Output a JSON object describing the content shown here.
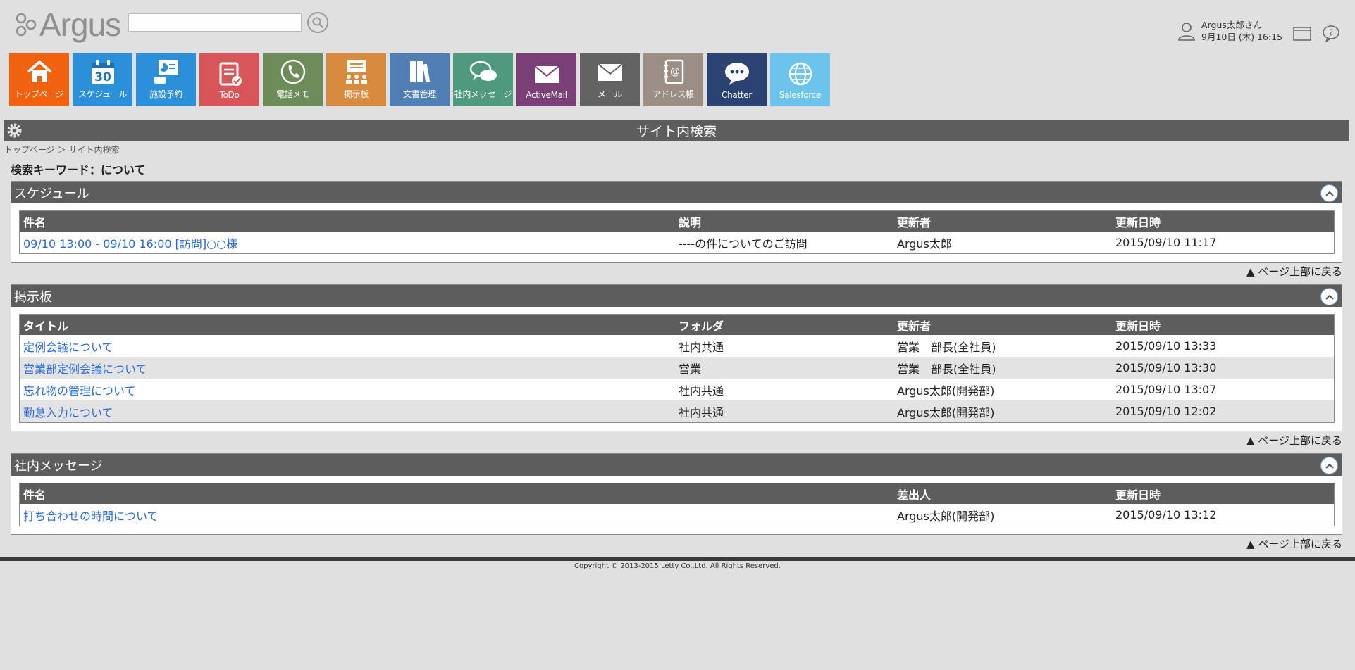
{
  "header": {
    "logo_text": "Argus",
    "search": {
      "value": "",
      "placeholder": ""
    },
    "user_name": "Argus太郎さん",
    "datetime": "9月10日 (木) 16:15"
  },
  "tiles": [
    {
      "label": "トップページ",
      "color": "#f0620f",
      "icon": "home-icon"
    },
    {
      "label": "スケジュール",
      "color": "#2b8fd9",
      "icon": "calendar-icon",
      "day": "30"
    },
    {
      "label": "施設予約",
      "color": "#2b8fd9",
      "icon": "facility-icon"
    },
    {
      "label": "ToDo",
      "color": "#d8565a",
      "icon": "todo-icon"
    },
    {
      "label": "電話メモ",
      "color": "#6d8c5a",
      "icon": "phone-icon"
    },
    {
      "label": "掲示板",
      "color": "#d88a3f",
      "icon": "board-icon"
    },
    {
      "label": "文書管理",
      "color": "#4f7fb5",
      "icon": "document-icon"
    },
    {
      "label": "社内メッセージ",
      "color": "#4f9a7e",
      "icon": "message-icon"
    },
    {
      "label": "ActiveMail",
      "color": "#7b3f78",
      "icon": "activemail-icon"
    },
    {
      "label": "メール",
      "color": "#636363",
      "icon": "mail-icon"
    },
    {
      "label": "アドレス帳",
      "color": "#9b8e85",
      "icon": "addressbook-icon"
    },
    {
      "label": "Chatter",
      "color": "#2b4373",
      "icon": "chatter-icon"
    },
    {
      "label": "Salesforce",
      "color": "#6cc4ec",
      "icon": "salesforce-icon"
    }
  ],
  "page_title": "サイト内検索",
  "breadcrumb": {
    "home": "トップページ",
    "separator": "＞",
    "current": "サイト内検索"
  },
  "keyword_line": "検索キーワード：について",
  "to_top_label": "▲ ページ上部に戻る",
  "sections": {
    "schedule": {
      "title": "スケジュール",
      "columns": [
        "件名",
        "説明",
        "更新者",
        "更新日時"
      ],
      "rows": [
        [
          "09/10 13:00 - 09/10 16:00 [訪問]○○様",
          "----の件についてのご訪問",
          "Argus太郎",
          "2015/09/10 11:17"
        ]
      ]
    },
    "board": {
      "title": "掲示板",
      "columns": [
        "タイトル",
        "フォルダ",
        "更新者",
        "更新日時"
      ],
      "rows": [
        [
          "定例会議について",
          "社内共通",
          "営業　部長(全社員)",
          "2015/09/10 13:33"
        ],
        [
          "営業部定例会議について",
          "営業",
          "営業　部長(全社員)",
          "2015/09/10 13:30"
        ],
        [
          "忘れ物の管理について",
          "社内共通",
          "Argus太郎(開発部)",
          "2015/09/10 13:07"
        ],
        [
          "勤怠入力について",
          "社内共通",
          "Argus太郎(開発部)",
          "2015/09/10 12:02"
        ]
      ]
    },
    "message": {
      "title": "社内メッセージ",
      "columns": [
        "件名",
        "",
        "差出人",
        "更新日時"
      ],
      "rows": [
        [
          "打ち合わせの時間について",
          "",
          "Argus太郎(開発部)",
          "2015/09/10 13:12"
        ]
      ]
    }
  },
  "copyright": "Copyright © 2013-2015 Letty Co.,Ltd. All Rights Reserved."
}
